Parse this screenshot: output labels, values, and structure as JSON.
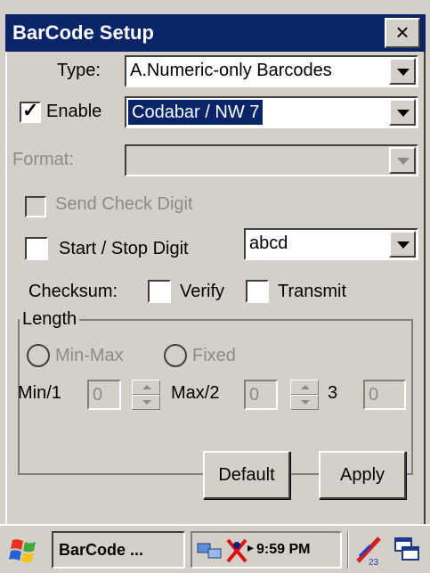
{
  "window": {
    "title": "BarCode Setup",
    "close_label": "×"
  },
  "form": {
    "type_label": "Type:",
    "type_value": "A.Numeric-only Barcodes",
    "enable_label": "Enable",
    "enable_checked": true,
    "enable_value": "Codabar / NW 7",
    "format_label": "Format:",
    "format_value": "",
    "send_check_digit_label": "Send Check Digit",
    "start_stop_label": "Start / Stop Digit",
    "start_stop_value": "abcd",
    "checksum_label": "Checksum:",
    "verify_label": "Verify",
    "transmit_label": "Transmit"
  },
  "length": {
    "group_label": "Length",
    "minmax_label": "Min-Max",
    "fixed_label": "Fixed",
    "min_label": "Min/1",
    "min_value": "0",
    "max_label": "Max/2",
    "max_value": "0",
    "third_label": "3",
    "third_value": "0"
  },
  "buttons": {
    "default_label": "Default",
    "apply_label": "Apply"
  },
  "taskbar": {
    "task_label": "BarCode ...",
    "clock": "9:59 PM"
  }
}
